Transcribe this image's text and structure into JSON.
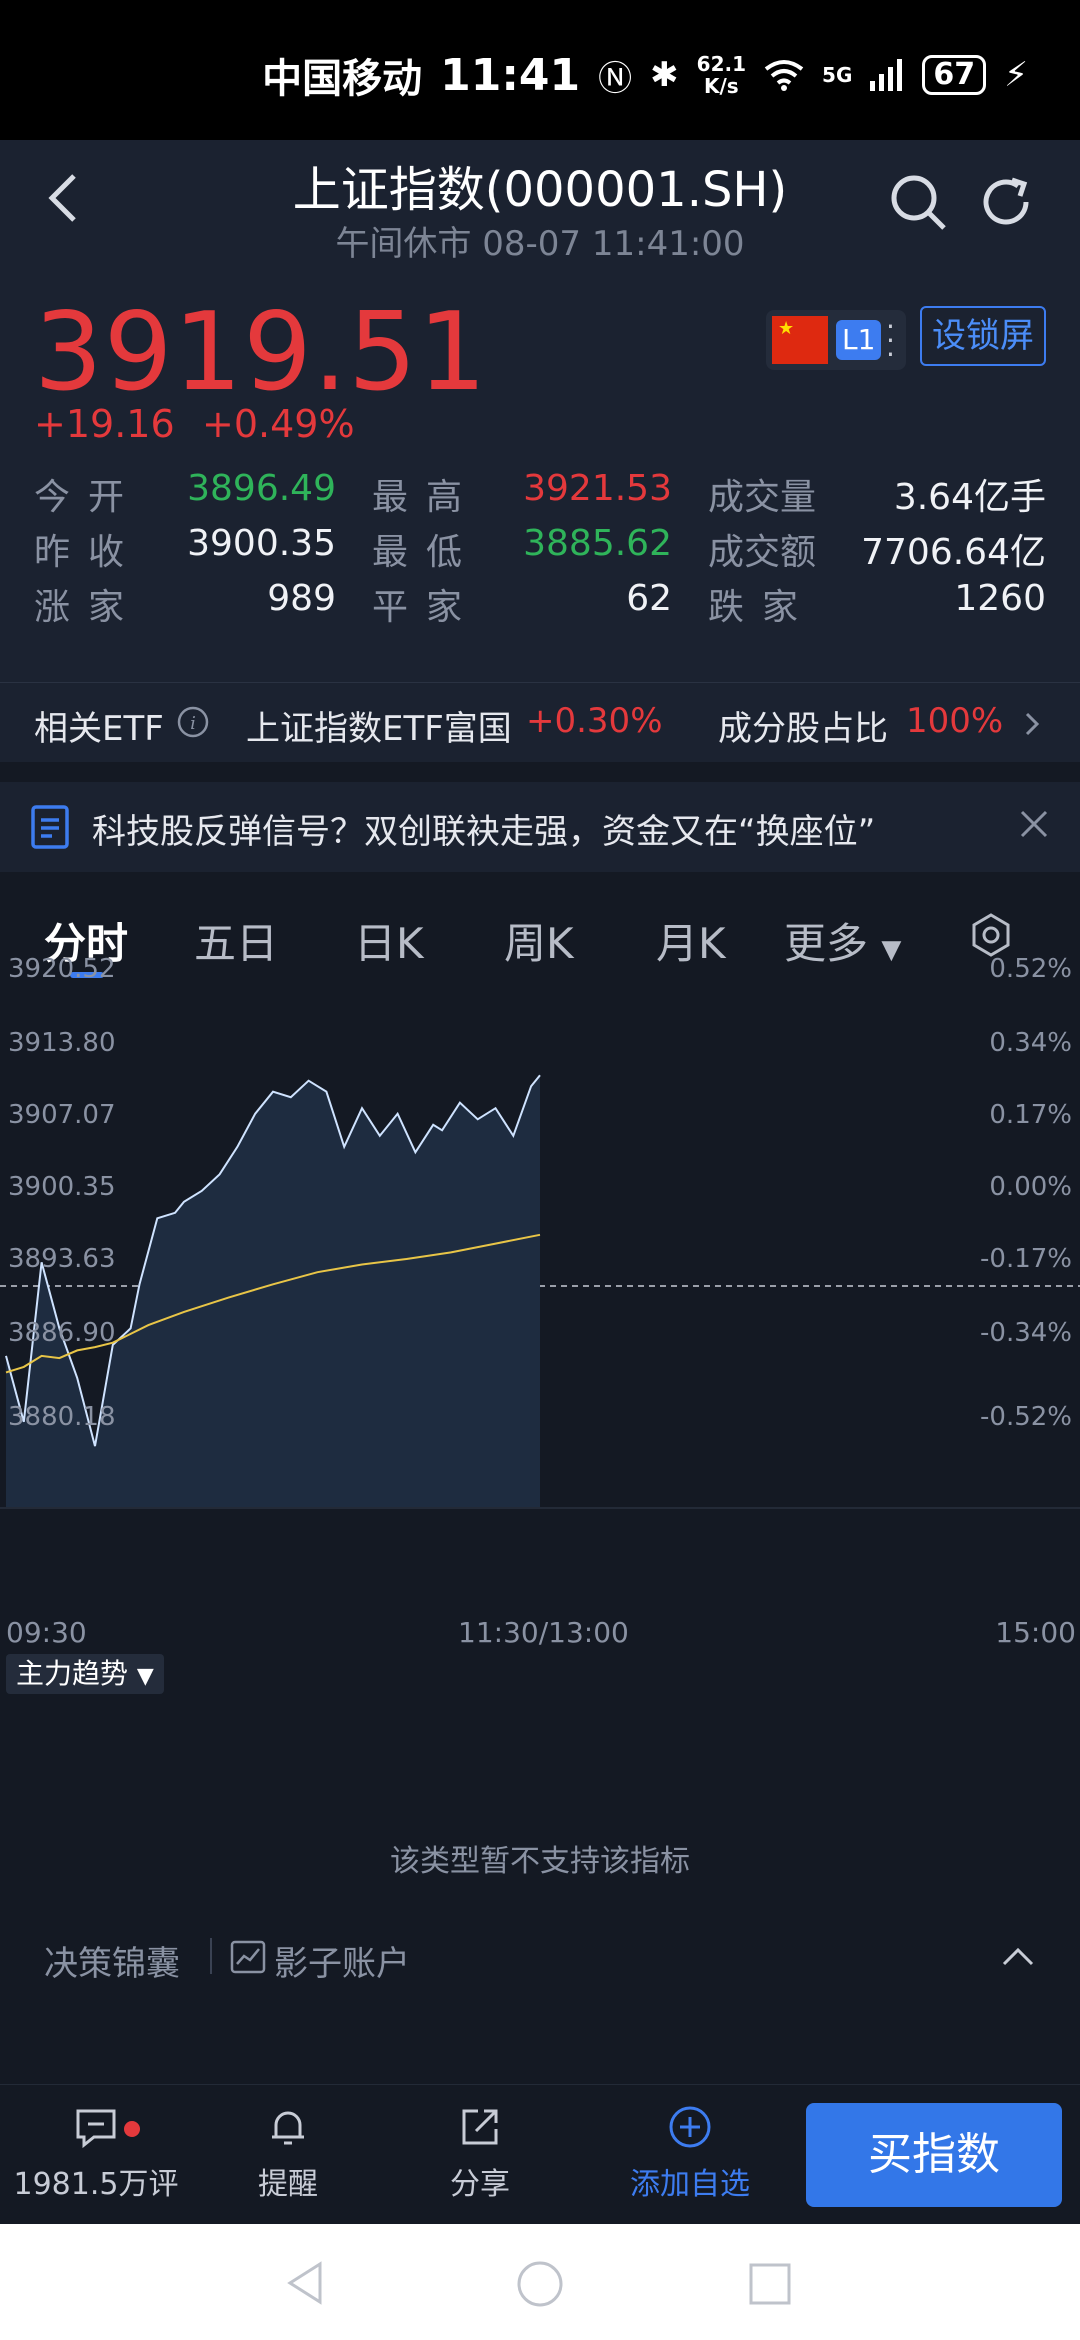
{
  "status_bar": {
    "carrier": "中国移动",
    "time": "11:41",
    "net_speed_top": "62.1",
    "net_speed_bottom": "K/s",
    "signal": "5G",
    "battery": "67"
  },
  "header": {
    "title": "上证指数(000001.SH)",
    "subtitle": "午间休市 08-07 11:41:00"
  },
  "quote": {
    "price": "3919.51",
    "change": "+19.16",
    "change_pct": "+0.49%",
    "level_badge": "L1",
    "lock_button": "设锁屏",
    "price_color": "#e4393c",
    "stats": [
      {
        "label1": "今开",
        "value1": "3896.49",
        "label2": "最高",
        "value2": "3921.53",
        "label3": "成交量",
        "value3": "3.64亿手"
      },
      {
        "label1": "昨收",
        "value1": "3900.35",
        "label2": "最低",
        "value2": "3885.62",
        "label3": "成交额",
        "value3": "7706.64亿"
      },
      {
        "label1": "涨家",
        "value1": "989",
        "label2": "平家",
        "value2": "62",
        "label3": "跌家",
        "value3": "1260"
      }
    ]
  },
  "etf": {
    "label": "相关ETF",
    "name": "上证指数ETF富国",
    "pct": "+0.30%",
    "ratio_label": "成分股占比",
    "ratio": "100%"
  },
  "news": {
    "text": "科技股反弹信号？双创联袂走强，资金又在“换座位”"
  },
  "tabs": [
    "分时",
    "五日",
    "日K",
    "周K",
    "月K",
    "更多"
  ],
  "chart_data": {
    "type": "line",
    "title": "",
    "y_ticks": [
      "3920.52",
      "3913.80",
      "3907.07",
      "3900.35",
      "3893.63",
      "3886.90",
      "3880.18"
    ],
    "pct_ticks": [
      "0.52%",
      "0.34%",
      "0.17%",
      "0.00%",
      "-0.17%",
      "-0.34%",
      "-0.52%"
    ],
    "x_ticks": [
      "09:30",
      "11:30/13:00",
      "15:00"
    ],
    "ylim": [
      3880.18,
      3920.52
    ],
    "reference": 3900.35,
    "series": [
      {
        "color": "#cfe3ff",
        "x": [
          0,
          4,
          8,
          12,
          16,
          20,
          24,
          28,
          30,
          34,
          38,
          40,
          44,
          48,
          52,
          56,
          60,
          64,
          68,
          72,
          76,
          80,
          84,
          88,
          92,
          96,
          98,
          102,
          106,
          110,
          114,
          118,
          120
        ],
        "values": [
          3894.0,
          3888.0,
          3902.5,
          3896.5,
          3892.0,
          3885.8,
          3895.0,
          3896.5,
          3900.5,
          3906.5,
          3907.0,
          3908.0,
          3909.0,
          3910.5,
          3913.0,
          3916.0,
          3918.0,
          3917.5,
          3919.0,
          3918.0,
          3913.0,
          3916.5,
          3914.0,
          3916.0,
          3912.5,
          3915.0,
          3914.5,
          3917.0,
          3915.5,
          3916.5,
          3914.0,
          3918.5,
          3919.5
        ]
      },
      {
        "color": "#e8c547",
        "x": [
          0,
          4,
          8,
          12,
          16,
          20,
          24,
          28,
          32,
          40,
          50,
          60,
          70,
          80,
          90,
          100,
          110,
          120
        ],
        "values": [
          3892.5,
          3893.0,
          3894.0,
          3893.8,
          3894.5,
          3894.8,
          3895.2,
          3896.0,
          3896.8,
          3898.0,
          3899.3,
          3900.5,
          3901.6,
          3902.3,
          3902.8,
          3903.4,
          3904.2,
          3905.0
        ]
      }
    ]
  },
  "indicator": {
    "label": "主力趋势",
    "message": "该类型暂不支持该指标"
  },
  "bottom_strip": {
    "left": "决策锦囊",
    "right": "影子账户"
  },
  "toolbar": {
    "comments": "1981.5万评",
    "remind": "提醒",
    "share": "分享",
    "add": "添加自选",
    "buy": "买指数"
  }
}
